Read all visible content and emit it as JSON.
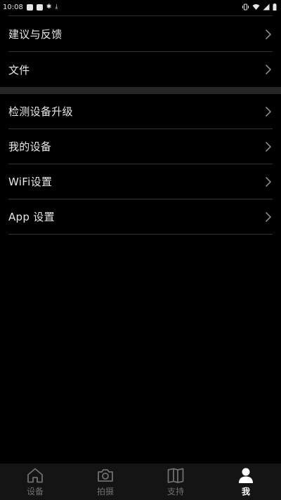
{
  "status_bar": {
    "time": "10:08",
    "icons_left": [
      "square-icon",
      "square-notification-icon",
      "bug-icon",
      "download-icon"
    ],
    "icons_right": [
      "vibrate-icon",
      "wifi-icon",
      "signal-icon",
      "battery-icon"
    ]
  },
  "menu": {
    "group1": [
      {
        "label": "建议与反馈"
      },
      {
        "label": "文件"
      }
    ],
    "group2": [
      {
        "label": "检测设备升级"
      },
      {
        "label": "我的设备"
      },
      {
        "label": "WiFi设置"
      },
      {
        "label": "App 设置"
      }
    ]
  },
  "tabs": [
    {
      "label": "设备",
      "icon": "home-icon",
      "active": false
    },
    {
      "label": "拍摄",
      "icon": "camera-icon",
      "active": false
    },
    {
      "label": "支持",
      "icon": "book-icon",
      "active": false
    },
    {
      "label": "我",
      "icon": "person-icon",
      "active": true
    }
  ],
  "colors": {
    "background": "#000000",
    "divider": "#333333",
    "section_gap": "#262626",
    "tab_bar": "#141414",
    "tab_inactive": "#6f6f6f",
    "tab_active": "#ffffff"
  }
}
